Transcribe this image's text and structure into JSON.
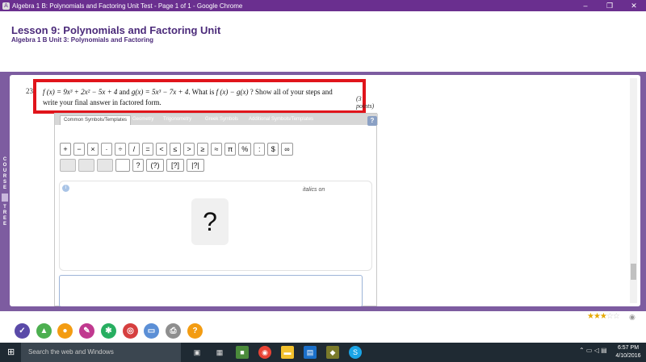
{
  "window": {
    "title": "Algebra 1 B: Polynomials and Factoring Unit Test - Page 1 of 1 - Google Chrome",
    "minimize": "–",
    "restore": "❐",
    "close": "✕"
  },
  "header": {
    "lesson_title": "Lesson 9: Polynomials and Factoring Unit",
    "subtitle": "Algebra 1 B  Unit 3: Polynomials and Factoring",
    "dots": "· ·"
  },
  "sidebar": {
    "letters": [
      "C",
      "O",
      "U",
      "R",
      "S",
      "E",
      "T",
      "R",
      "E",
      "E"
    ]
  },
  "question": {
    "number": "23.",
    "f_def": "f (x) = 9x³ + 2x² − 5x + 4",
    "and": "and",
    "g_def": "g(x) = 5x³ − 7x + 4",
    "prompt_1": ". What is",
    "expr": "f (x) − g(x)",
    "prompt_2": "? Show all of your steps and write your final answer in factored form.",
    "points": "(3 points)"
  },
  "editor": {
    "tabs": [
      "Common Symbols/Templates",
      "Geometry",
      "Trigonometry",
      "Greek Symbols",
      "Additional Symbols/Templates"
    ],
    "help": "?",
    "row1": [
      "+",
      "−",
      "×",
      "·",
      "÷",
      "/",
      "=",
      "<",
      "≤",
      ">",
      "≥",
      "≈",
      "π",
      "%",
      ":",
      "$",
      "∞"
    ],
    "row2": [
      "?",
      "(?)",
      "[?]",
      "|?|"
    ],
    "italics": "italics on",
    "placeholder_symbol": "?",
    "info": "i"
  },
  "rating": {
    "stars_on": "★★★",
    "stars_off": "☆☆"
  },
  "taskbar": {
    "search": "Search the web and Windows",
    "time": "6:57 PM",
    "date": "4/10/2016"
  },
  "colors": {
    "brand_purple": "#7d5ca0",
    "highlight_red": "#e0141b",
    "title_purple": "#4b2a7a"
  }
}
